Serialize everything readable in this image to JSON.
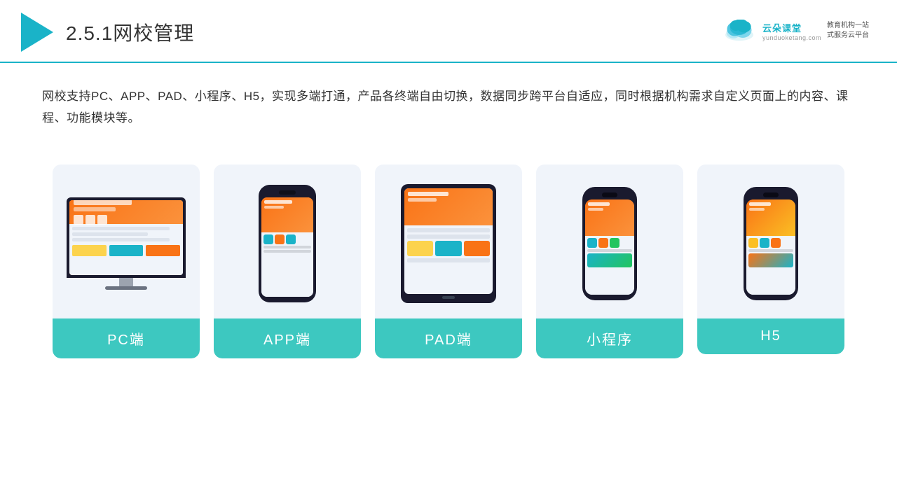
{
  "header": {
    "title": "2.5.1网校管理",
    "title_number": "2.5.1",
    "title_text": "网校管理"
  },
  "brand": {
    "name": "云朵课堂",
    "url": "yunduoketang.com",
    "slogan_line1": "教育机构一站",
    "slogan_line2": "式服务云平台"
  },
  "description": {
    "text": "网校支持PC、APP、PAD、小程序、H5，实现多端打通，产品各终端自由切换，数据同步跨平台自适应，同时根据机构需求自定义页面上的内容、课程、功能模块等。"
  },
  "cards": [
    {
      "id": "pc",
      "label": "PC端"
    },
    {
      "id": "app",
      "label": "APP端"
    },
    {
      "id": "pad",
      "label": "PAD端"
    },
    {
      "id": "miniprogram",
      "label": "小程序"
    },
    {
      "id": "h5",
      "label": "H5"
    }
  ]
}
